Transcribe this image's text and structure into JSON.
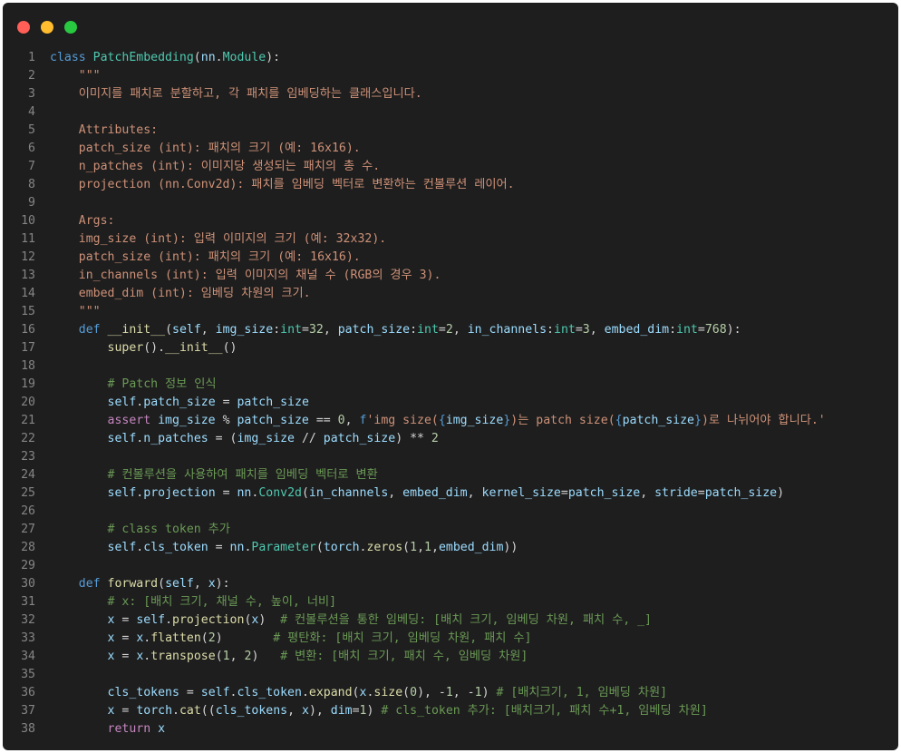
{
  "window": {
    "controls": [
      {
        "name": "close",
        "color": "#ff5f57"
      },
      {
        "name": "minimize",
        "color": "#febc2e"
      },
      {
        "name": "zoom",
        "color": "#28c840"
      }
    ]
  },
  "editor": {
    "lines": [
      {
        "n": "1",
        "t": [
          [
            "kw",
            "class "
          ],
          [
            "cls",
            "PatchEmbedding"
          ],
          [
            "op",
            "("
          ],
          [
            "var",
            "nn"
          ],
          [
            "op",
            "."
          ],
          [
            "cls",
            "Module"
          ],
          [
            "op",
            "):"
          ]
        ]
      },
      {
        "n": "2",
        "t": [
          [
            "str",
            "    \"\"\""
          ]
        ]
      },
      {
        "n": "3",
        "t": [
          [
            "str",
            "    이미지를 패치로 분할하고, 각 패치를 임베딩하는 클래스입니다."
          ]
        ]
      },
      {
        "n": "4",
        "t": []
      },
      {
        "n": "5",
        "t": [
          [
            "str",
            "    Attributes:"
          ]
        ]
      },
      {
        "n": "6",
        "t": [
          [
            "str",
            "    patch_size (int): 패치의 크기 (예: 16x16)."
          ]
        ]
      },
      {
        "n": "7",
        "t": [
          [
            "str",
            "    n_patches (int): 이미지당 생성되는 패치의 총 수."
          ]
        ]
      },
      {
        "n": "8",
        "t": [
          [
            "str",
            "    projection (nn.Conv2d): 패치를 임베딩 벡터로 변환하는 컨볼루션 레이어."
          ]
        ]
      },
      {
        "n": "9",
        "t": []
      },
      {
        "n": "10",
        "t": [
          [
            "str",
            "    Args:"
          ]
        ]
      },
      {
        "n": "11",
        "t": [
          [
            "str",
            "    img_size (int): 입력 이미지의 크기 (예: 32x32)."
          ]
        ]
      },
      {
        "n": "12",
        "t": [
          [
            "str",
            "    patch_size (int): 패치의 크기 (예: 16x16)."
          ]
        ]
      },
      {
        "n": "13",
        "t": [
          [
            "str",
            "    in_channels (int): 입력 이미지의 채널 수 (RGB의 경우 3)."
          ]
        ]
      },
      {
        "n": "14",
        "t": [
          [
            "str",
            "    embed_dim (int): 임베딩 차원의 크기."
          ]
        ]
      },
      {
        "n": "15",
        "t": [
          [
            "str",
            "    \"\"\""
          ]
        ]
      },
      {
        "n": "16",
        "t": [
          [
            "op",
            "    "
          ],
          [
            "kw",
            "def "
          ],
          [
            "fn",
            "__init__"
          ],
          [
            "op",
            "("
          ],
          [
            "var",
            "self"
          ],
          [
            "op",
            ", "
          ],
          [
            "var",
            "img_size"
          ],
          [
            "op",
            ":"
          ],
          [
            "cls",
            "int"
          ],
          [
            "op",
            "="
          ],
          [
            "num",
            "32"
          ],
          [
            "op",
            ", "
          ],
          [
            "var",
            "patch_size"
          ],
          [
            "op",
            ":"
          ],
          [
            "cls",
            "int"
          ],
          [
            "op",
            "="
          ],
          [
            "num",
            "2"
          ],
          [
            "op",
            ", "
          ],
          [
            "var",
            "in_channels"
          ],
          [
            "op",
            ":"
          ],
          [
            "cls",
            "int"
          ],
          [
            "op",
            "="
          ],
          [
            "num",
            "3"
          ],
          [
            "op",
            ", "
          ],
          [
            "var",
            "embed_dim"
          ],
          [
            "op",
            ":"
          ],
          [
            "cls",
            "int"
          ],
          [
            "op",
            "="
          ],
          [
            "num",
            "768"
          ],
          [
            "op",
            "):"
          ]
        ]
      },
      {
        "n": "17",
        "t": [
          [
            "op",
            "        "
          ],
          [
            "fn",
            "super"
          ],
          [
            "op",
            "()."
          ],
          [
            "fn",
            "__init__"
          ],
          [
            "op",
            "()"
          ]
        ]
      },
      {
        "n": "18",
        "t": []
      },
      {
        "n": "19",
        "t": [
          [
            "cmt",
            "        # Patch 정보 인식"
          ]
        ]
      },
      {
        "n": "20",
        "t": [
          [
            "op",
            "        "
          ],
          [
            "var",
            "self"
          ],
          [
            "op",
            "."
          ],
          [
            "var",
            "patch_size"
          ],
          [
            "op",
            " = "
          ],
          [
            "var",
            "patch_size"
          ]
        ]
      },
      {
        "n": "21",
        "t": [
          [
            "op",
            "        "
          ],
          [
            "ctrl",
            "assert "
          ],
          [
            "var",
            "img_size"
          ],
          [
            "op",
            " % "
          ],
          [
            "var",
            "patch_size"
          ],
          [
            "op",
            " == "
          ],
          [
            "num",
            "0"
          ],
          [
            "op",
            ", "
          ],
          [
            "kw",
            "f"
          ],
          [
            "str",
            "'img size("
          ],
          [
            "kw",
            "{"
          ],
          [
            "var",
            "img_size"
          ],
          [
            "kw",
            "}"
          ],
          [
            "str",
            ")는 patch size("
          ],
          [
            "kw",
            "{"
          ],
          [
            "var",
            "patch_size"
          ],
          [
            "kw",
            "}"
          ],
          [
            "str",
            ")로 나뉘어야 합니다.'"
          ]
        ]
      },
      {
        "n": "22",
        "t": [
          [
            "op",
            "        "
          ],
          [
            "var",
            "self"
          ],
          [
            "op",
            "."
          ],
          [
            "var",
            "n_patches"
          ],
          [
            "op",
            " = ("
          ],
          [
            "var",
            "img_size"
          ],
          [
            "op",
            " // "
          ],
          [
            "var",
            "patch_size"
          ],
          [
            "op",
            ") ** "
          ],
          [
            "num",
            "2"
          ]
        ]
      },
      {
        "n": "23",
        "t": []
      },
      {
        "n": "24",
        "t": [
          [
            "cmt",
            "        # 컨볼루션을 사용하여 패치를 임베딩 벡터로 변환"
          ]
        ]
      },
      {
        "n": "25",
        "t": [
          [
            "op",
            "        "
          ],
          [
            "var",
            "self"
          ],
          [
            "op",
            "."
          ],
          [
            "var",
            "projection"
          ],
          [
            "op",
            " = "
          ],
          [
            "var",
            "nn"
          ],
          [
            "op",
            "."
          ],
          [
            "cls",
            "Conv2d"
          ],
          [
            "op",
            "("
          ],
          [
            "var",
            "in_channels"
          ],
          [
            "op",
            ", "
          ],
          [
            "var",
            "embed_dim"
          ],
          [
            "op",
            ", "
          ],
          [
            "var",
            "kernel_size"
          ],
          [
            "op",
            "="
          ],
          [
            "var",
            "patch_size"
          ],
          [
            "op",
            ", "
          ],
          [
            "var",
            "stride"
          ],
          [
            "op",
            "="
          ],
          [
            "var",
            "patch_size"
          ],
          [
            "op",
            ")"
          ]
        ]
      },
      {
        "n": "26",
        "t": []
      },
      {
        "n": "27",
        "t": [
          [
            "cmt",
            "        # class token 추가"
          ]
        ]
      },
      {
        "n": "28",
        "t": [
          [
            "op",
            "        "
          ],
          [
            "var",
            "self"
          ],
          [
            "op",
            "."
          ],
          [
            "var",
            "cls_token"
          ],
          [
            "op",
            " = "
          ],
          [
            "var",
            "nn"
          ],
          [
            "op",
            "."
          ],
          [
            "cls",
            "Parameter"
          ],
          [
            "op",
            "("
          ],
          [
            "var",
            "torch"
          ],
          [
            "op",
            "."
          ],
          [
            "fn",
            "zeros"
          ],
          [
            "op",
            "("
          ],
          [
            "num",
            "1"
          ],
          [
            "op",
            ","
          ],
          [
            "num",
            "1"
          ],
          [
            "op",
            ","
          ],
          [
            "var",
            "embed_dim"
          ],
          [
            "op",
            "))"
          ]
        ]
      },
      {
        "n": "29",
        "t": []
      },
      {
        "n": "30",
        "t": [
          [
            "op",
            "    "
          ],
          [
            "kw",
            "def "
          ],
          [
            "fn",
            "forward"
          ],
          [
            "op",
            "("
          ],
          [
            "var",
            "self"
          ],
          [
            "op",
            ", "
          ],
          [
            "var",
            "x"
          ],
          [
            "op",
            "):"
          ]
        ]
      },
      {
        "n": "31",
        "t": [
          [
            "cmt",
            "        # x: [배치 크기, 채널 수, 높이, 너비]"
          ]
        ]
      },
      {
        "n": "32",
        "t": [
          [
            "op",
            "        "
          ],
          [
            "var",
            "x"
          ],
          [
            "op",
            " = "
          ],
          [
            "var",
            "self"
          ],
          [
            "op",
            "."
          ],
          [
            "fn",
            "projection"
          ],
          [
            "op",
            "("
          ],
          [
            "var",
            "x"
          ],
          [
            "op",
            ")  "
          ],
          [
            "cmt",
            "# 컨볼루션을 통한 임베딩: [배치 크기, 임베딩 차원, 패치 수, _]"
          ]
        ]
      },
      {
        "n": "33",
        "t": [
          [
            "op",
            "        "
          ],
          [
            "var",
            "x"
          ],
          [
            "op",
            " = "
          ],
          [
            "var",
            "x"
          ],
          [
            "op",
            "."
          ],
          [
            "fn",
            "flatten"
          ],
          [
            "op",
            "("
          ],
          [
            "num",
            "2"
          ],
          [
            "op",
            ")       "
          ],
          [
            "cmt",
            "# 평탄화: [배치 크기, 임베딩 차원, 패치 수]"
          ]
        ]
      },
      {
        "n": "34",
        "t": [
          [
            "op",
            "        "
          ],
          [
            "var",
            "x"
          ],
          [
            "op",
            " = "
          ],
          [
            "var",
            "x"
          ],
          [
            "op",
            "."
          ],
          [
            "fn",
            "transpose"
          ],
          [
            "op",
            "("
          ],
          [
            "num",
            "1"
          ],
          [
            "op",
            ", "
          ],
          [
            "num",
            "2"
          ],
          [
            "op",
            ")   "
          ],
          [
            "cmt",
            "# 변환: [배치 크기, 패치 수, 임베딩 차원]"
          ]
        ]
      },
      {
        "n": "35",
        "t": []
      },
      {
        "n": "36",
        "t": [
          [
            "op",
            "        "
          ],
          [
            "var",
            "cls_tokens"
          ],
          [
            "op",
            " = "
          ],
          [
            "var",
            "self"
          ],
          [
            "op",
            "."
          ],
          [
            "var",
            "cls_token"
          ],
          [
            "op",
            "."
          ],
          [
            "fn",
            "expand"
          ],
          [
            "op",
            "("
          ],
          [
            "var",
            "x"
          ],
          [
            "op",
            "."
          ],
          [
            "fn",
            "size"
          ],
          [
            "op",
            "("
          ],
          [
            "num",
            "0"
          ],
          [
            "op",
            "), -"
          ],
          [
            "num",
            "1"
          ],
          [
            "op",
            ", -"
          ],
          [
            "num",
            "1"
          ],
          [
            "op",
            ") "
          ],
          [
            "cmt",
            "# [배치크기, 1, 임베딩 차원]"
          ]
        ]
      },
      {
        "n": "37",
        "t": [
          [
            "op",
            "        "
          ],
          [
            "var",
            "x"
          ],
          [
            "op",
            " = "
          ],
          [
            "var",
            "torch"
          ],
          [
            "op",
            "."
          ],
          [
            "fn",
            "cat"
          ],
          [
            "op",
            "(("
          ],
          [
            "var",
            "cls_tokens"
          ],
          [
            "op",
            ", "
          ],
          [
            "var",
            "x"
          ],
          [
            "op",
            "), "
          ],
          [
            "var",
            "dim"
          ],
          [
            "op",
            "="
          ],
          [
            "num",
            "1"
          ],
          [
            "op",
            ") "
          ],
          [
            "cmt",
            "# cls_token 추가: [배치크기, 패치 수+1, 임베딩 차원]"
          ]
        ]
      },
      {
        "n": "38",
        "t": [
          [
            "op",
            "        "
          ],
          [
            "ctrl",
            "return "
          ],
          [
            "var",
            "x"
          ]
        ]
      }
    ]
  }
}
